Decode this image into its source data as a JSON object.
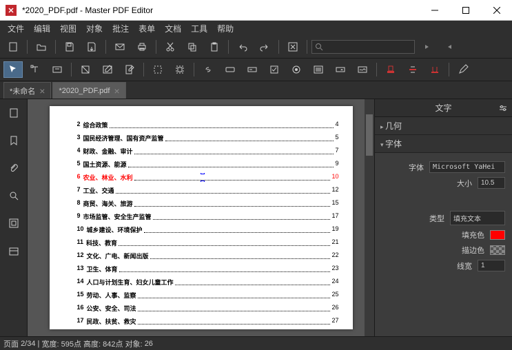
{
  "titlebar": {
    "icon_text": "",
    "title": "*2020_PDF.pdf - Master PDF Editor"
  },
  "menu": [
    "文件",
    "编辑",
    "视图",
    "对象",
    "批注",
    "表单",
    "文档",
    "工具",
    "帮助"
  ],
  "tabs": [
    {
      "label": "*未命名",
      "active": false
    },
    {
      "label": "*2020_PDF.pdf",
      "active": true
    }
  ],
  "toc": [
    {
      "num": "2",
      "title": "综合政策",
      "page": "4"
    },
    {
      "num": "3",
      "title": "国民经济管理、国有资产监管",
      "page": "5"
    },
    {
      "num": "4",
      "title": "财政、金融、审计",
      "page": "7"
    },
    {
      "num": "5",
      "title": "国土资源、能源",
      "page": "9"
    },
    {
      "num": "6",
      "title": "农业、林业、水利",
      "page": "10",
      "selected": true
    },
    {
      "num": "7",
      "title": "工业、交通",
      "page": "12"
    },
    {
      "num": "8",
      "title": "商贸、海关、旅游",
      "page": "15"
    },
    {
      "num": "9",
      "title": "市场监管、安全生产监管",
      "page": "17"
    },
    {
      "num": "10",
      "title": "城乡建设、环境保护",
      "page": "19"
    },
    {
      "num": "11",
      "title": "科技、教育",
      "page": "21"
    },
    {
      "num": "12",
      "title": "文化、广电、新闻出版",
      "page": "22"
    },
    {
      "num": "13",
      "title": "卫生、体育",
      "page": "23"
    },
    {
      "num": "14",
      "title": "人口与计划生育、妇女儿童工作",
      "page": "24"
    },
    {
      "num": "15",
      "title": "劳动、人事、监察",
      "page": "25"
    },
    {
      "num": "16",
      "title": "公安、安全、司法",
      "page": "26"
    },
    {
      "num": "17",
      "title": "民政、扶贫、救灾",
      "page": "27"
    }
  ],
  "panel": {
    "title": "文字",
    "sections": {
      "geometry": "几何",
      "font": "字体"
    },
    "font_label": "字体",
    "font_value": "Microsoft YaHei",
    "size_label": "大小",
    "size_value": "10.5",
    "type_label": "类型",
    "type_value": "填充文本",
    "fill_label": "填充色",
    "fill_color": "#ff0000",
    "stroke_label": "描边色",
    "stroke_color": "transparent",
    "linewidth_label": "线宽",
    "linewidth_value": "1"
  },
  "status": {
    "page_label": "页面",
    "page": "2/34",
    "width_label": "宽度:",
    "width": "595点",
    "height_label": "高度:",
    "height": "842点",
    "objects_label": "对象:",
    "objects": "26"
  }
}
